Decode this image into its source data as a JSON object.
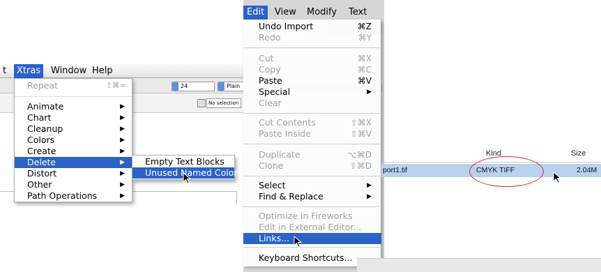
{
  "xtras_panel": {
    "menubar": [
      "t",
      "Xtras",
      "Window",
      "Help"
    ],
    "toolbar": {
      "font_size": "24",
      "font_style": "Plain"
    },
    "selection_field": "No selection",
    "menu_items": [
      {
        "label": "Repeat",
        "shortcut": "⇧⌘=",
        "disabled": true
      },
      {
        "label": "Animate",
        "submenu": true
      },
      {
        "label": "Chart",
        "submenu": true
      },
      {
        "label": "Cleanup",
        "submenu": true
      },
      {
        "label": "Colors",
        "submenu": true
      },
      {
        "label": "Create",
        "submenu": true
      },
      {
        "label": "Delete",
        "submenu": true,
        "highlighted": true
      },
      {
        "label": "Distort",
        "submenu": true
      },
      {
        "label": "Other",
        "submenu": true
      },
      {
        "label": "Path Operations",
        "submenu": true
      }
    ],
    "delete_submenu": [
      {
        "label": "Empty Text Blocks"
      },
      {
        "label": "Unused Named Colors",
        "highlighted": true
      }
    ]
  },
  "edit_panel": {
    "menubar": [
      "Edit",
      "View",
      "Modify",
      "Text"
    ],
    "menu_items": [
      {
        "label": "Undo Import",
        "shortcut": "⌘Z"
      },
      {
        "label": "Redo",
        "shortcut": "⌘Y",
        "disabled": true
      },
      {
        "label": "Cut",
        "shortcut": "⌘X",
        "disabled": true
      },
      {
        "label": "Copy",
        "shortcut": "⌘C",
        "disabled": true
      },
      {
        "label": "Paste",
        "shortcut": "⌘V"
      },
      {
        "label": "Special",
        "submenu": true
      },
      {
        "label": "Clear",
        "disabled": true
      },
      {
        "label": "Cut Contents",
        "shortcut": "⇧⌘X",
        "disabled": true
      },
      {
        "label": "Paste Inside",
        "shortcut": "⇧⌘V",
        "disabled": true
      },
      {
        "label": "Duplicate",
        "shortcut": "⌥⌘D",
        "disabled": true
      },
      {
        "label": "Clone",
        "shortcut": "⇧⌘D",
        "disabled": true
      },
      {
        "label": "Select",
        "submenu": true
      },
      {
        "label": "Find & Replace",
        "submenu": true
      },
      {
        "label": "Optimize in Fireworks",
        "disabled": true
      },
      {
        "label": "Edit in External Editor...",
        "disabled": true
      },
      {
        "label": "Links...",
        "highlighted": true
      },
      {
        "label": "Keyboard Shortcuts..."
      }
    ]
  },
  "file_list": {
    "columns": [
      "Kind",
      "Size"
    ],
    "row": {
      "name": "port1.tif",
      "kind": "CMYK TIFF",
      "size": "2.04M"
    }
  },
  "colors": {
    "highlight": "#2b62c7",
    "annotation": "#d92a2a",
    "selected_row": "#b8d1ee"
  }
}
